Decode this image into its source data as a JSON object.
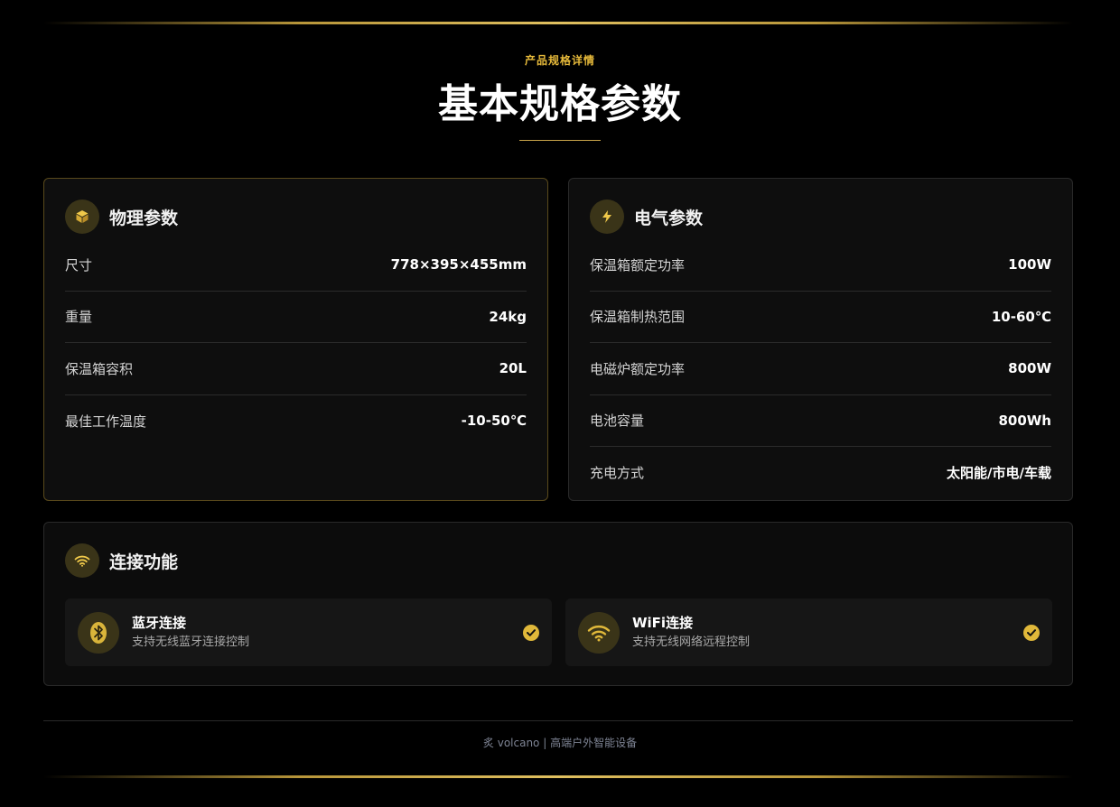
{
  "header": {
    "eyebrow": "产品规格详情",
    "title": "基本规格参数"
  },
  "physical": {
    "title": "物理参数",
    "icon": "box-icon",
    "rows": [
      {
        "label": "尺寸",
        "value": "778×395×455mm"
      },
      {
        "label": "重量",
        "value": "24kg"
      },
      {
        "label": "保温箱容积",
        "value": "20L"
      },
      {
        "label": "最佳工作温度",
        "value": "-10-50℃"
      }
    ]
  },
  "electric": {
    "title": "电气参数",
    "icon": "bolt-icon",
    "rows": [
      {
        "label": "保温箱额定功率",
        "value": "100W"
      },
      {
        "label": "保温箱制热范围",
        "value": "10-60℃"
      },
      {
        "label": "电磁炉额定功率",
        "value": "800W"
      },
      {
        "label": "电池容量",
        "value": "800Wh"
      },
      {
        "label": "充电方式",
        "value": "太阳能/市电/车载"
      }
    ]
  },
  "connect": {
    "title": "连接功能",
    "icon": "wifi-icon",
    "features": [
      {
        "title": "蓝牙连接",
        "desc": "支持无线蓝牙连接控制",
        "icon": "bluetooth-icon"
      },
      {
        "title": "WiFi连接",
        "desc": "支持无线网络远程控制",
        "icon": "wifi-icon"
      }
    ]
  },
  "footer": {
    "text": "炙 volcano | 高端户外智能设备"
  },
  "colors": {
    "accent": "#e0b83a",
    "background": "#000000",
    "card": "#0e0e0e"
  }
}
